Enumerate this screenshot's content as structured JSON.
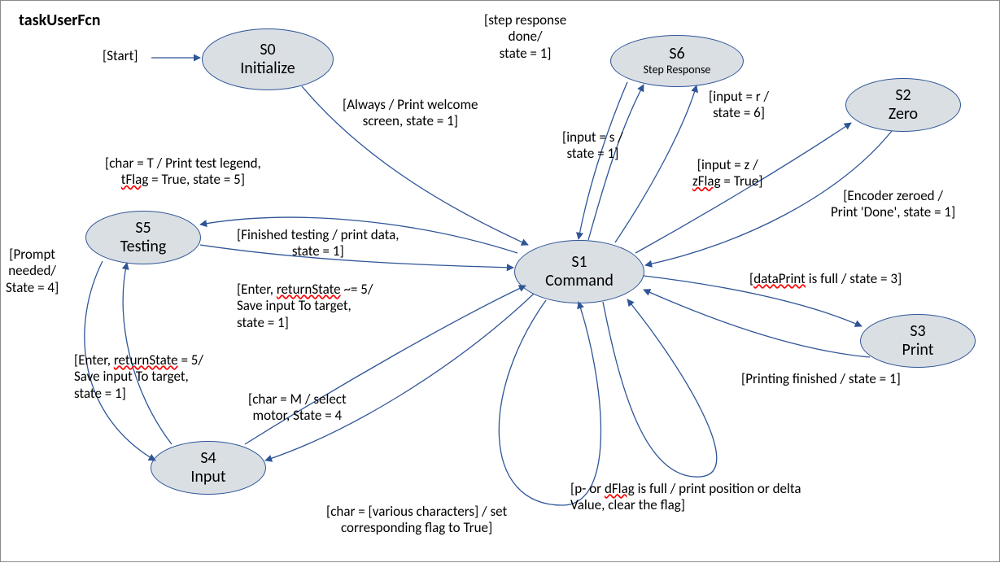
{
  "title": "taskUserFcn",
  "states": {
    "s0": {
      "code": "S0",
      "name": "Initialize"
    },
    "s1": {
      "code": "S1",
      "name": "Command"
    },
    "s2": {
      "code": "S2",
      "name": "Zero"
    },
    "s3": {
      "code": "S3",
      "name": "Print"
    },
    "s4": {
      "code": "S4",
      "name": "Input"
    },
    "s5": {
      "code": "S5",
      "name": "Testing"
    },
    "s6": {
      "code": "S6",
      "name": "Step Response"
    }
  },
  "labels": {
    "start": "[Start]",
    "s0_s1_a": "[Always / Print welcome",
    "s0_s1_b": "screen, state = 1]",
    "s6_s1_a": "[step response",
    "s6_s1_b": "done/",
    "s6_s1_c": "state = 1]",
    "s1_s6_a": "[input = r /",
    "s1_s6_b": "state = 6]",
    "s1_s6x_a": "[input = s /",
    "s1_s6x_b": "state = 1]",
    "s1_s2_a": "[input = z /",
    "s1_s2_b_pre": "",
    "s1_s2_b_squig": "zFlag",
    "s1_s2_b_post": " = True]",
    "s2_s1_a": "[Encoder zeroed /",
    "s2_s1_b": "Print 'Done', state = 1]",
    "s1_s3_pre": "[",
    "s1_s3_squig": "dataPrint",
    "s1_s3_post": " is full / state = 3]",
    "s3_s1": "[Printing finished / state = 1]",
    "s1_s5_a": "[char = T / Print test legend,",
    "s1_s5_b_squig": "tFlag",
    "s1_s5_b_post": " = True, state = 5]",
    "s5_s1_a": "[Finished testing / print data,",
    "s5_s1_b": "state = 1]",
    "s5_s4_a": "[Prompt",
    "s5_s4_b": "needed/",
    "s5_s4_c": "State = 4]",
    "s4_s5_a": "[Enter, ",
    "s4_s5_a_squig": "returnState",
    "s4_s5_a_post": " = 5/",
    "s4_s5_b": "Save input To target,",
    "s4_s5_c": "state = 1]",
    "s4_s1_a": "[Enter, ",
    "s4_s1_a_squig": "returnState",
    "s4_s1_a_post": " ~= 5/",
    "s4_s1_b": "Save input To target,",
    "s4_s1_c": "state = 1]",
    "s1_s4_a": "[char = M / select",
    "s1_s4_b": "motor, State = 4",
    "loop_flag_a": "[char = [various characters] / set",
    "loop_flag_b": "corresponding flag to True]",
    "loop_pd_a_pre": "[p- or ",
    "loop_pd_a_squig": "dFlag",
    "loop_pd_a_post": " is full / print position or delta",
    "loop_pd_b": "Value, clear the flag]"
  }
}
